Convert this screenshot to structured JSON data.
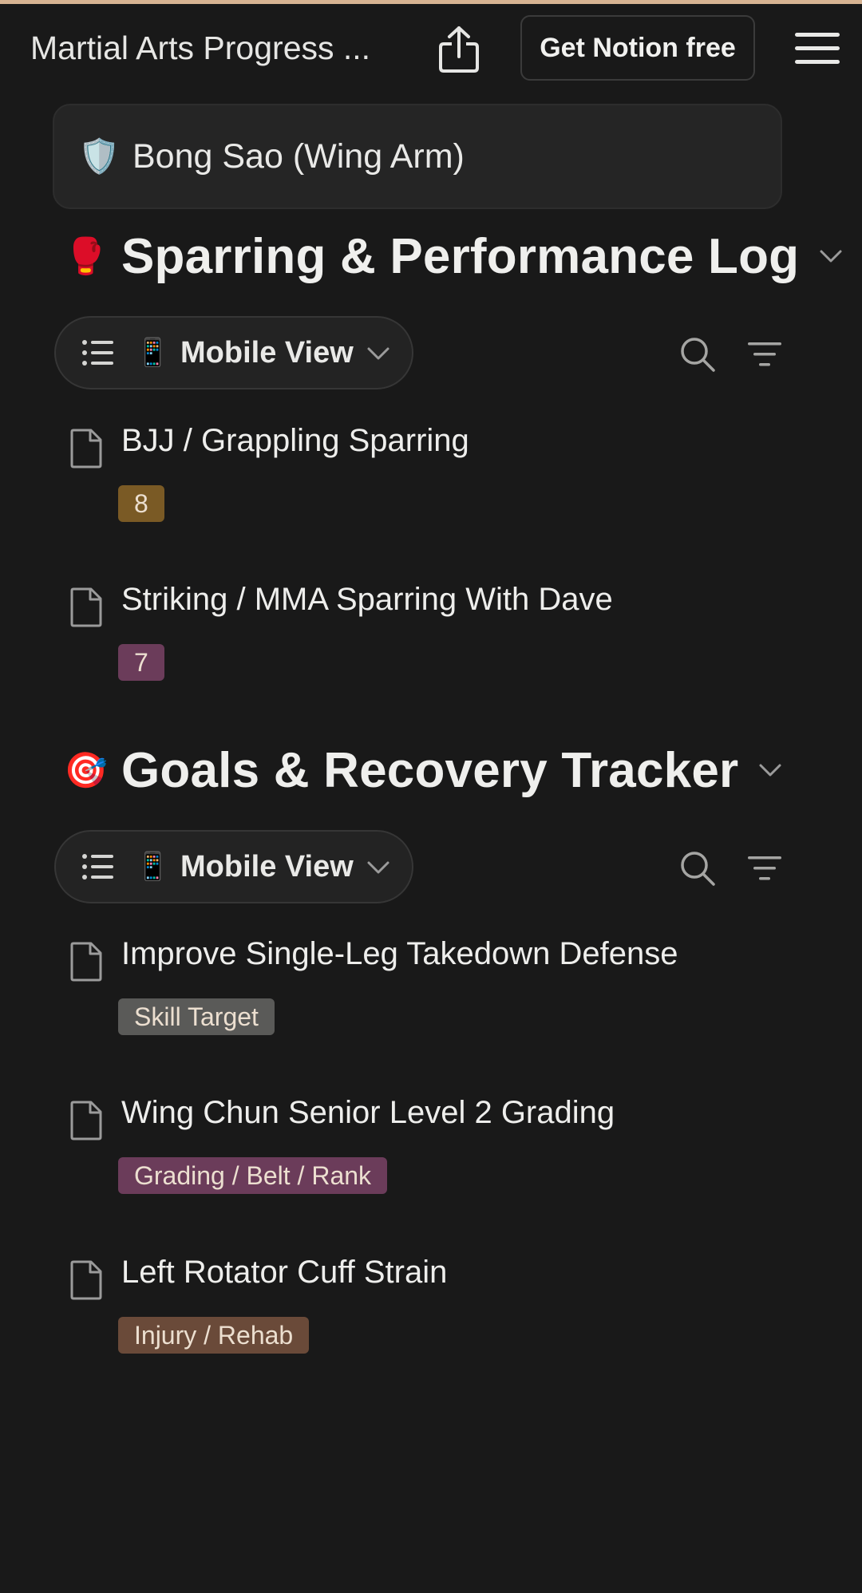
{
  "topbar": {
    "title": "Martial Arts Progress ...",
    "cta_label": "Get Notion free",
    "share_icon": "share-icon",
    "menu_icon": "hamburger-menu-icon"
  },
  "linked_page": {
    "emoji": "🛡️",
    "label": "Bong Sao (Wing Arm)"
  },
  "sections": [
    {
      "emoji": "🥊",
      "title": "Sparring & Performance Log",
      "view": {
        "emoji": "📱",
        "label": "Mobile View"
      },
      "items": [
        {
          "title": "BJJ / Grappling Sparring",
          "tag": "8",
          "tag_color": "#7a5a25"
        },
        {
          "title": "Striking / MMA Sparring With Dave",
          "tag": "7",
          "tag_color": "#6b3c5a"
        }
      ]
    },
    {
      "emoji": "🎯",
      "title": "Goals & Recovery Tracker",
      "view": {
        "emoji": "📱",
        "label": "Mobile View"
      },
      "items": [
        {
          "title": "Improve Single-Leg Takedown Defense",
          "tag": "Skill Target",
          "tag_color": "#5a5a58"
        },
        {
          "title": "Wing Chun Senior Level 2 Grading",
          "tag": "Grading / Belt / Rank",
          "tag_color": "#6b3c5a"
        },
        {
          "title": "Left Rotator Cuff Strain",
          "tag": "Injury / Rehab",
          "tag_color": "#6a4a39"
        }
      ]
    }
  ],
  "colors": {
    "background": "#191919",
    "card": "#252525",
    "accent_line": "#d7b392"
  }
}
